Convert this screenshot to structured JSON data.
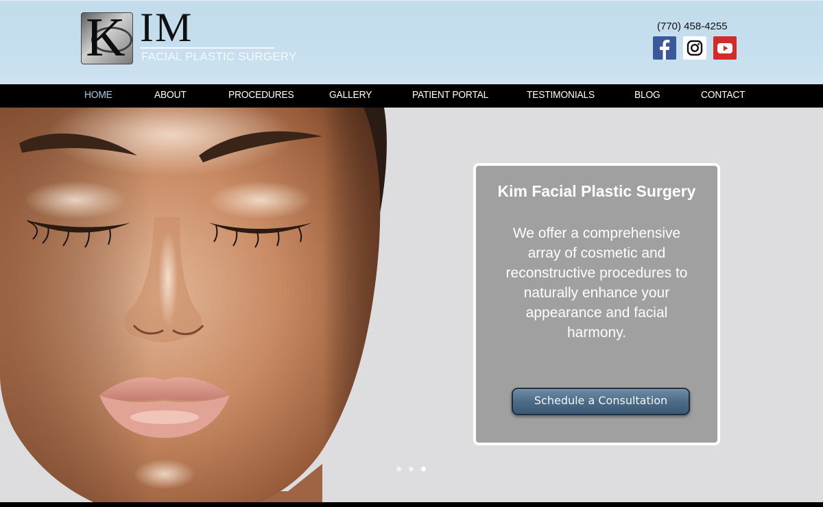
{
  "header": {
    "logo_letter": "K",
    "logo_name": "IM",
    "logo_subtitle": "FACIAL PLASTIC SURGERY",
    "phone": "(770) 458-4255",
    "social": [
      {
        "name": "facebook",
        "icon": "facebook-icon",
        "color": "#3b5998"
      },
      {
        "name": "instagram",
        "icon": "instagram-icon",
        "color": "#ffffff"
      },
      {
        "name": "youtube",
        "icon": "youtube-icon",
        "color": "#d22b2b"
      }
    ]
  },
  "nav": {
    "items": [
      {
        "label": "HOME",
        "active": true
      },
      {
        "label": "ABOUT",
        "active": false
      },
      {
        "label": "PROCEDURES",
        "active": false
      },
      {
        "label": "GALLERY",
        "active": false
      },
      {
        "label": "PATIENT PORTAL",
        "active": false
      },
      {
        "label": "TESTIMONIALS",
        "active": false
      },
      {
        "label": "BLOG",
        "active": false
      },
      {
        "label": "CONTACT",
        "active": false
      }
    ],
    "active_color": "#a8cde6"
  },
  "hero": {
    "card_title": "Kim Facial Plastic Surgery",
    "card_text": "We offer a comprehensive array of cosmetic and reconstructive procedures to naturally enhance your appearance and facial harmony.",
    "cta_label": "Schedule a Consultation",
    "slides_count": 3,
    "active_slide": 3
  },
  "colors": {
    "header_bg": "#c4ddee",
    "nav_bg": "#000000",
    "card_bg": "#a0a0a0",
    "cta_bg": "#4d6c88"
  }
}
